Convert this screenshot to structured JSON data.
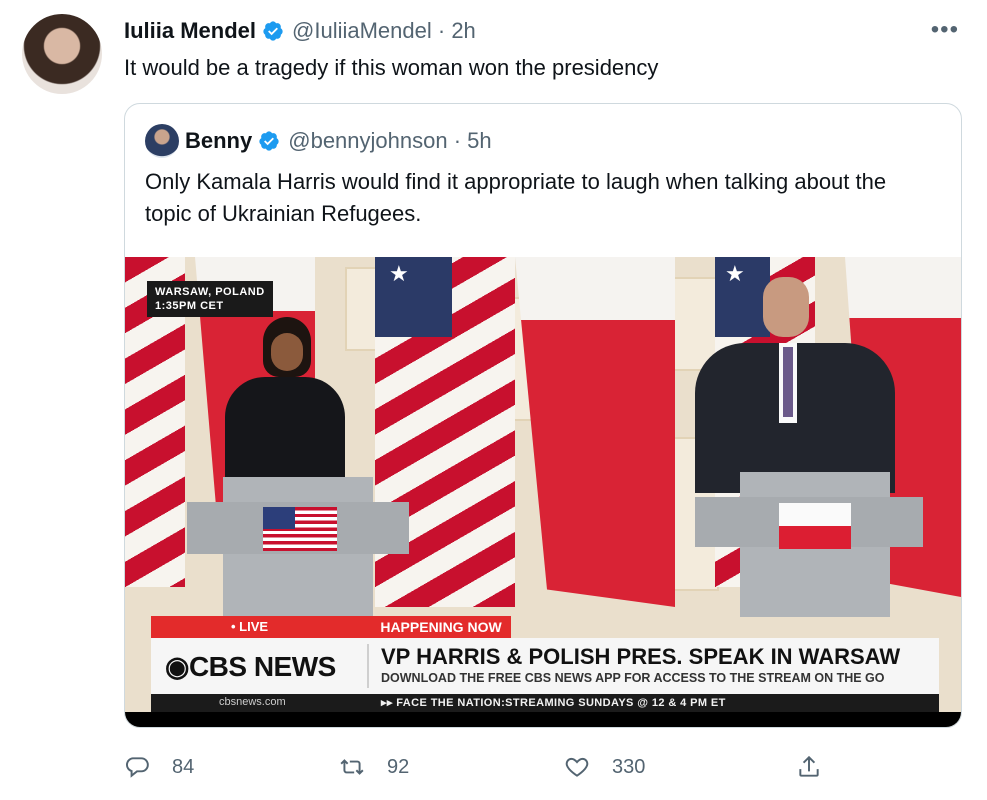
{
  "tweet": {
    "author_name": "Iuliia Mendel",
    "handle_time": "@IuliiaMendel · 2h",
    "text": "It would be a tragedy if this woman won the presidency",
    "more": "•••"
  },
  "quoted": {
    "author_name": "Benny",
    "handle_time": "@bennyjohnson · 5h",
    "text": "Only Kamala Harris would find it appropriate to laugh when talking about the topic of Ukrainian Refugees."
  },
  "video": {
    "location_line1": "WARSAW, POLAND",
    "location_line2": "1:35PM CET",
    "live_label": "• LIVE",
    "happening_label": "HAPPENING NOW",
    "network": "CBS NEWS",
    "headline": "VP HARRIS & POLISH PRES. SPEAK IN WARSAW",
    "subheadline": "DOWNLOAD THE FREE CBS NEWS APP FOR ACCESS TO THE STREAM ON THE GO",
    "site": "cbsnews.com",
    "ticker": "▸▸ FACE THE NATION:STREAMING SUNDAYS @ 12 & 4 PM ET"
  },
  "actions": {
    "replies": "84",
    "retweets": "92",
    "likes": "330"
  },
  "colors": {
    "verified": "#1d9bf0",
    "secondary_text": "#536471",
    "cbs_red": "#e32b2b"
  }
}
